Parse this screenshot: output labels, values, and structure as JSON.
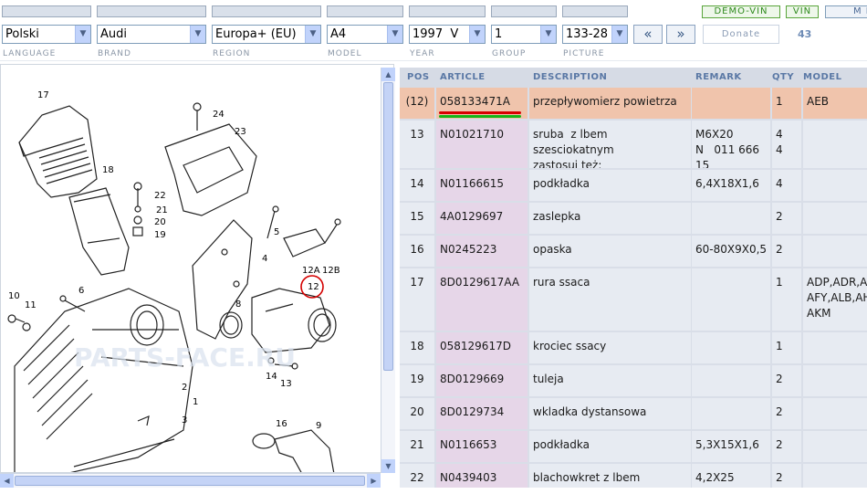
{
  "top_buttons": {
    "demo_vin": "DEMO-VIN",
    "vin": "VIN",
    "menu": "M E"
  },
  "selectors": {
    "language": "Polski",
    "brand": "Audi",
    "region": "Europa+ (EU)",
    "model": "A4",
    "year": "1997  V",
    "group": "1",
    "picture": "133-28"
  },
  "nav": {
    "prev": "«",
    "next": "»",
    "donate": "Donate",
    "picture_count": "43"
  },
  "labels": {
    "language": "LANGUAGE",
    "brand": "BRAND",
    "region": "REGION",
    "model": "MODEL",
    "year": "YEAR",
    "group": "GROUP",
    "picture": "PICTURE"
  },
  "diagram": {
    "watermark": "PARTS-FACE.RU",
    "callouts": [
      "17",
      "24",
      "23",
      "18",
      "22",
      "21",
      "20",
      "19",
      "5",
      "4",
      "12A",
      "12B",
      "12",
      "6",
      "10",
      "11",
      "8",
      "14",
      "13",
      "2",
      "1",
      "3",
      "16",
      "9"
    ]
  },
  "table": {
    "headers": {
      "pos": "POS",
      "article": "ARTICLE",
      "description": "DESCRIPTION",
      "remark": "REMARK",
      "qty": "QTY",
      "model": "MODEL"
    },
    "rows": [
      {
        "pos": "(12)",
        "article": "058133471A",
        "description": "przepływomierz powietrza",
        "remark": "",
        "qty": "1",
        "model": "AEB",
        "selected": true
      },
      {
        "pos": "13",
        "article": "N01021710",
        "description": "sruba  z lbem szesciokatnym\nzastosuj też:",
        "remark": "M6X20\nN   011 666 15",
        "qty": "4\n4",
        "model": ""
      },
      {
        "pos": "14",
        "article": "N01166615",
        "description": "podkładka",
        "remark": "6,4X18X1,6",
        "qty": "4",
        "model": ""
      },
      {
        "pos": "15",
        "article": "4A0129697",
        "description": "zaslepka",
        "remark": "",
        "qty": "2",
        "model": ""
      },
      {
        "pos": "16",
        "article": "N0245223",
        "description": "opaska",
        "remark": "60-80X9X0,5",
        "qty": "2",
        "model": ""
      },
      {
        "pos": "17",
        "article": "8D0129617AA",
        "description": "rura ssaca",
        "remark": "",
        "qty": "1",
        "model": "ADP,ADR,AEB\nAFY,ALB,AHL\nAKM"
      },
      {
        "pos": "18",
        "article": "058129617D",
        "description": "krociec ssacy",
        "remark": "",
        "qty": "1",
        "model": ""
      },
      {
        "pos": "19",
        "article": "8D0129669",
        "description": "tuleja",
        "remark": "",
        "qty": "2",
        "model": ""
      },
      {
        "pos": "20",
        "article": "8D0129734",
        "description": "wkladka dystansowa",
        "remark": "",
        "qty": "2",
        "model": ""
      },
      {
        "pos": "21",
        "article": "N0116653",
        "description": "podkładka",
        "remark": "5,3X15X1,6",
        "qty": "2",
        "model": ""
      },
      {
        "pos": "22",
        "article": "N0439403",
        "description": "blachowkret z lbem soczewko",
        "remark": "4,2X25",
        "qty": "2",
        "model": ""
      }
    ]
  },
  "colors": {
    "selected_row": "#f0c4ac",
    "article_col": "#e6d6e8",
    "header_text": "#5a78a5",
    "underline_red": "#d80000",
    "underline_green": "#16b516"
  }
}
